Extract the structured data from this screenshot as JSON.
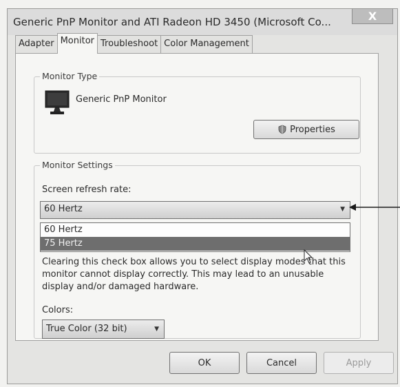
{
  "window": {
    "title": "Generic PnP Monitor and ATI Radeon HD 3450 (Microsoft Co...",
    "close_glyph": "X"
  },
  "tabs": [
    {
      "label": "Adapter",
      "active": false
    },
    {
      "label": "Monitor",
      "active": true
    },
    {
      "label": "Troubleshoot",
      "active": false
    },
    {
      "label": "Color Management",
      "active": false
    }
  ],
  "monitor_type": {
    "group_label": "Monitor Type",
    "monitor_name": "Generic PnP Monitor",
    "properties_label": "Properties",
    "monitor_icon": "monitor-icon",
    "shield_icon": "shield-icon"
  },
  "monitor_settings": {
    "group_label": "Monitor Settings",
    "refresh_label": "Screen refresh rate:",
    "refresh_selected": "60 Hertz",
    "refresh_options": [
      "60 Hertz",
      "75 Hertz"
    ],
    "refresh_highlighted": "75 Hertz",
    "warning_text": "Clearing this check box allows you to select display modes that this monitor cannot display correctly. This may lead to an unusable display and/or damaged hardware.",
    "colors_label": "Colors:",
    "colors_selected": "True Color (32 bit)"
  },
  "buttons": {
    "ok": "OK",
    "cancel": "Cancel",
    "apply": "Apply"
  },
  "colors": {
    "highlight": "#6e6e6e",
    "window_bg": "#e4e4e2",
    "panel_bg": "#f6f6f4"
  }
}
